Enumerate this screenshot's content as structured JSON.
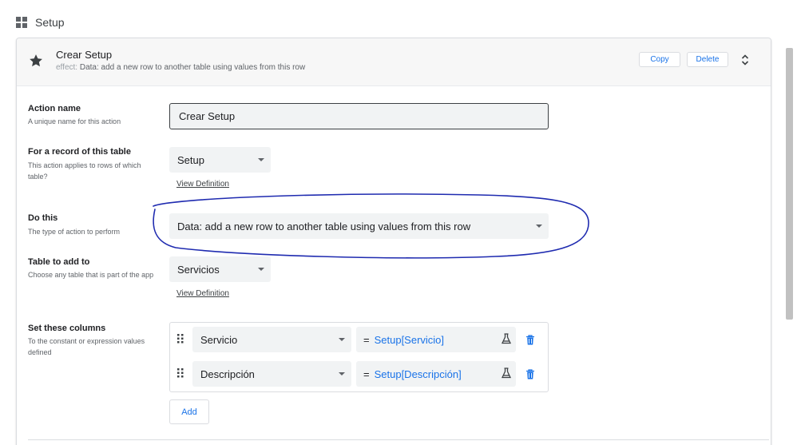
{
  "page": {
    "title": "Setup"
  },
  "header": {
    "title": "Crear Setup",
    "effect_key": "effect:",
    "effect_value": "Data: add a new row to another table using values from this row",
    "copy_label": "Copy",
    "delete_label": "Delete"
  },
  "form": {
    "action_name": {
      "label": "Action name",
      "hint": "A unique name for this action",
      "value": "Crear Setup"
    },
    "table": {
      "label": "For a record of this table",
      "hint": "This action applies to rows of which table?",
      "value": "Setup",
      "link": "View Definition"
    },
    "do_this": {
      "label": "Do this",
      "hint": "The type of action to perform",
      "value": "Data: add a new row to another table using values from this row"
    },
    "table_to_add": {
      "label": "Table to add to",
      "hint": "Choose any table that is part of the app",
      "value": "Servicios",
      "link": "View Definition"
    },
    "set_columns": {
      "label": "Set these columns",
      "hint": "To the constant or expression values defined",
      "rows": [
        {
          "column": "Servicio",
          "eq": "=",
          "expression": "Setup[Servicio]"
        },
        {
          "column": "Descripción",
          "eq": "=",
          "expression": "Setup[Descripción]"
        }
      ],
      "add_label": "Add"
    }
  },
  "colors": {
    "accent": "#1a73e8",
    "annotation": "#1f2bb0"
  },
  "icons": [
    "grid-icon",
    "star-icon",
    "expand-icon",
    "chevron-down-icon",
    "drag-handle-icon",
    "flask-icon",
    "trash-icon"
  ]
}
